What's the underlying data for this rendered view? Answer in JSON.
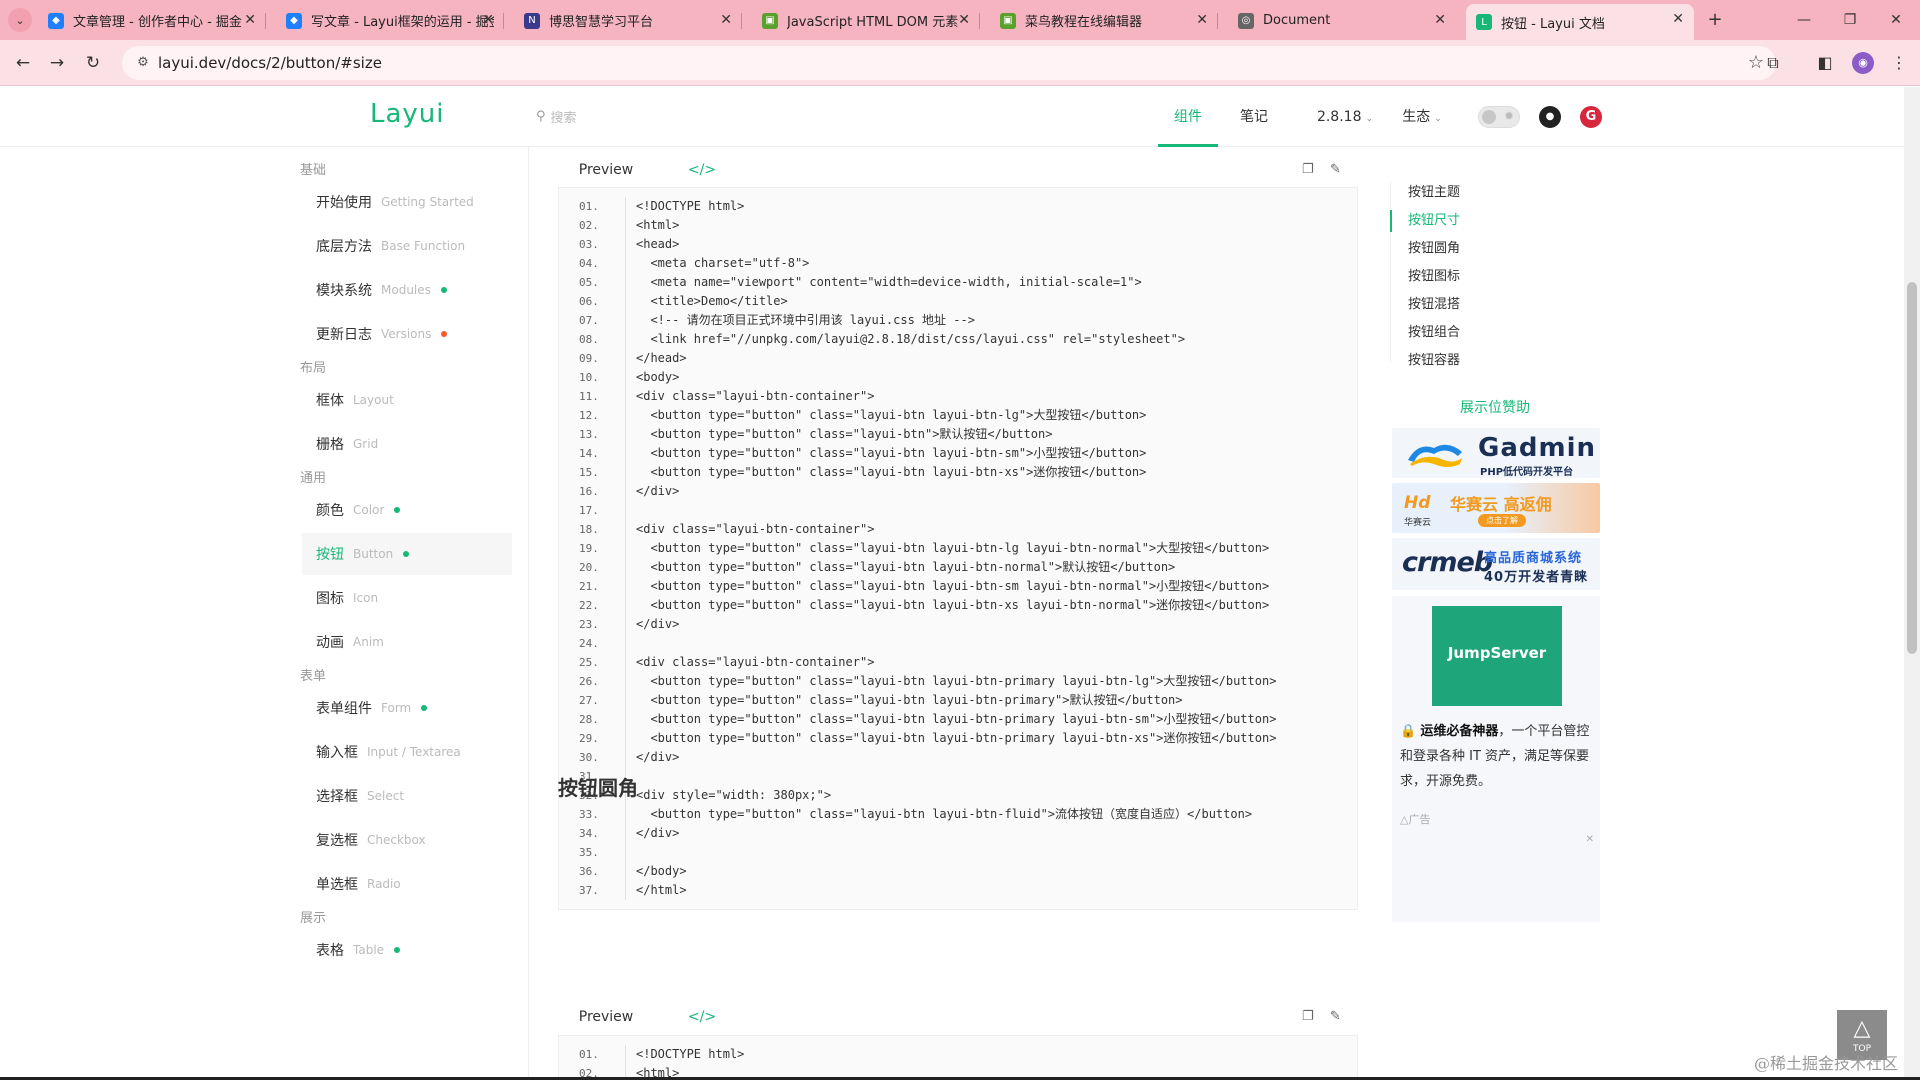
{
  "browser": {
    "tabs": [
      {
        "title": "文章管理 - 创作者中心 - 掘金",
        "icon": "juejin-icon",
        "color": "#1e80ff",
        "glyph": "◆"
      },
      {
        "title": "写文章 - Layui框架的运用 - 掘金",
        "icon": "juejin-icon",
        "color": "#1e80ff",
        "glyph": "◆"
      },
      {
        "title": "博思智慧学习平台",
        "icon": "boss-icon",
        "color": "#3a3a8c",
        "glyph": "N"
      },
      {
        "title": "JavaScript HTML DOM 元素",
        "icon": "runoob-icon",
        "color": "#5aa02c",
        "glyph": "▣"
      },
      {
        "title": "菜鸟教程在线编辑器",
        "icon": "runoob-icon",
        "color": "#5aa02c",
        "glyph": "▣"
      },
      {
        "title": "Document",
        "icon": "globe-icon",
        "color": "#666666",
        "glyph": "◎"
      },
      {
        "title": "按钮 - Layui 文档",
        "icon": "layui-icon",
        "color": "#16b777",
        "glyph": "L"
      }
    ],
    "active_tab": 6,
    "url": "layui.dev/docs/2/button/#size"
  },
  "header": {
    "logo": "Layui",
    "search_placeholder": "搜索",
    "nav": [
      {
        "label": "组件",
        "active": true
      },
      {
        "label": "笔记",
        "active": false
      },
      {
        "label": "2.8.18",
        "active": false,
        "caret": true
      },
      {
        "label": "生态",
        "active": false,
        "caret": true
      }
    ]
  },
  "sidebar": {
    "groups": [
      {
        "title": "基础",
        "items": [
          {
            "cn": "开始使用",
            "en": "Getting Started",
            "dot": ""
          },
          {
            "cn": "底层方法",
            "en": "Base Function",
            "dot": ""
          },
          {
            "cn": "模块系统",
            "en": "Modules",
            "dot": "#16b777"
          },
          {
            "cn": "更新日志",
            "en": "Versions",
            "dot": "#ff5722"
          }
        ]
      },
      {
        "title": "布局",
        "items": [
          {
            "cn": "框体",
            "en": "Layout",
            "dot": ""
          },
          {
            "cn": "栅格",
            "en": "Grid",
            "dot": ""
          }
        ]
      },
      {
        "title": "通用",
        "items": [
          {
            "cn": "颜色",
            "en": "Color",
            "dot": "#16b777"
          },
          {
            "cn": "按钮",
            "en": "Button",
            "dot": "#16b777",
            "active": true
          },
          {
            "cn": "图标",
            "en": "Icon",
            "dot": ""
          },
          {
            "cn": "动画",
            "en": "Anim",
            "dot": ""
          }
        ]
      },
      {
        "title": "表单",
        "items": [
          {
            "cn": "表单组件",
            "en": "Form",
            "dot": "#16b777"
          },
          {
            "cn": "输入框",
            "en": "Input / Textarea",
            "dot": ""
          },
          {
            "cn": "选择框",
            "en": "Select",
            "dot": ""
          },
          {
            "cn": "复选框",
            "en": "Checkbox",
            "dot": ""
          },
          {
            "cn": "单选框",
            "en": "Radio",
            "dot": ""
          }
        ]
      },
      {
        "title": "展示",
        "items": [
          {
            "cn": "表格",
            "en": "Table",
            "dot": "#16b777"
          }
        ]
      }
    ]
  },
  "demo_tabs": {
    "preview": "Preview",
    "code": "</>"
  },
  "code_block_1": [
    "<!DOCTYPE html>",
    "<html>",
    "<head>",
    "  <meta charset=\"utf-8\">",
    "  <meta name=\"viewport\" content=\"width=device-width, initial-scale=1\">",
    "  <title>Demo</title>",
    "  <!-- 请勿在项目正式环境中引用该 layui.css 地址 -->",
    "  <link href=\"//unpkg.com/layui@2.8.18/dist/css/layui.css\" rel=\"stylesheet\">",
    "</head>",
    "<body>",
    "<div class=\"layui-btn-container\">",
    "  <button type=\"button\" class=\"layui-btn layui-btn-lg\">大型按钮</button>",
    "  <button type=\"button\" class=\"layui-btn\">默认按钮</button>",
    "  <button type=\"button\" class=\"layui-btn layui-btn-sm\">小型按钮</button>",
    "  <button type=\"button\" class=\"layui-btn layui-btn-xs\">迷你按钮</button>",
    "</div>",
    "",
    "<div class=\"layui-btn-container\">",
    "  <button type=\"button\" class=\"layui-btn layui-btn-lg layui-btn-normal\">大型按钮</button>",
    "  <button type=\"button\" class=\"layui-btn layui-btn-normal\">默认按钮</button>",
    "  <button type=\"button\" class=\"layui-btn layui-btn-sm layui-btn-normal\">小型按钮</button>",
    "  <button type=\"button\" class=\"layui-btn layui-btn-xs layui-btn-normal\">迷你按钮</button>",
    "</div>",
    "",
    "<div class=\"layui-btn-container\">",
    "  <button type=\"button\" class=\"layui-btn layui-btn-primary layui-btn-lg\">大型按钮</button>",
    "  <button type=\"button\" class=\"layui-btn layui-btn-primary\">默认按钮</button>",
    "  <button type=\"button\" class=\"layui-btn layui-btn-primary layui-btn-sm\">小型按钮</button>",
    "  <button type=\"button\" class=\"layui-btn layui-btn-primary layui-btn-xs\">迷你按钮</button>",
    "</div>",
    "",
    "<div style=\"width: 380px;\">",
    "  <button type=\"button\" class=\"layui-btn layui-btn-fluid\">流体按钮（宽度自适应）</button>",
    "</div>",
    "",
    "</body>",
    "</html>"
  ],
  "section_title": "按钮圆角",
  "code_block_2": [
    "<!DOCTYPE html>",
    "<html>"
  ],
  "toc": [
    {
      "label": "按钮主题",
      "active": false
    },
    {
      "label": "按钮尺寸",
      "active": true
    },
    {
      "label": "按钮圆角",
      "active": false
    },
    {
      "label": "按钮图标",
      "active": false
    },
    {
      "label": "按钮混搭",
      "active": false
    },
    {
      "label": "按钮组合",
      "active": false
    },
    {
      "label": "按钮容器",
      "active": false
    }
  ],
  "sponsor": {
    "title": "展示位赞助",
    "gadmin": {
      "name": "Gadmin",
      "sub": "PHP低代码开发平台"
    },
    "huasai": {
      "logo": "华赛云",
      "title": "华赛云 高返佣",
      "button": "点击了解"
    },
    "crmeb": {
      "logo": "crmeb",
      "line1": "高品质商城系统",
      "line2": "40万开发者青睐"
    },
    "jumpserver": {
      "name": "JumpServer",
      "desc_bold": "运维必备神器",
      "desc_rest": "，一个平台管控和登录各种 IT 资产，满足等保要求，开源免费。",
      "tag": "广告"
    }
  },
  "gotop": "TOP",
  "watermark": "@稀土掘金技术社区",
  "colors": {
    "accent": "#16b777",
    "tabbar": "#f6b3c0",
    "toolbar": "#fbe1e6"
  }
}
